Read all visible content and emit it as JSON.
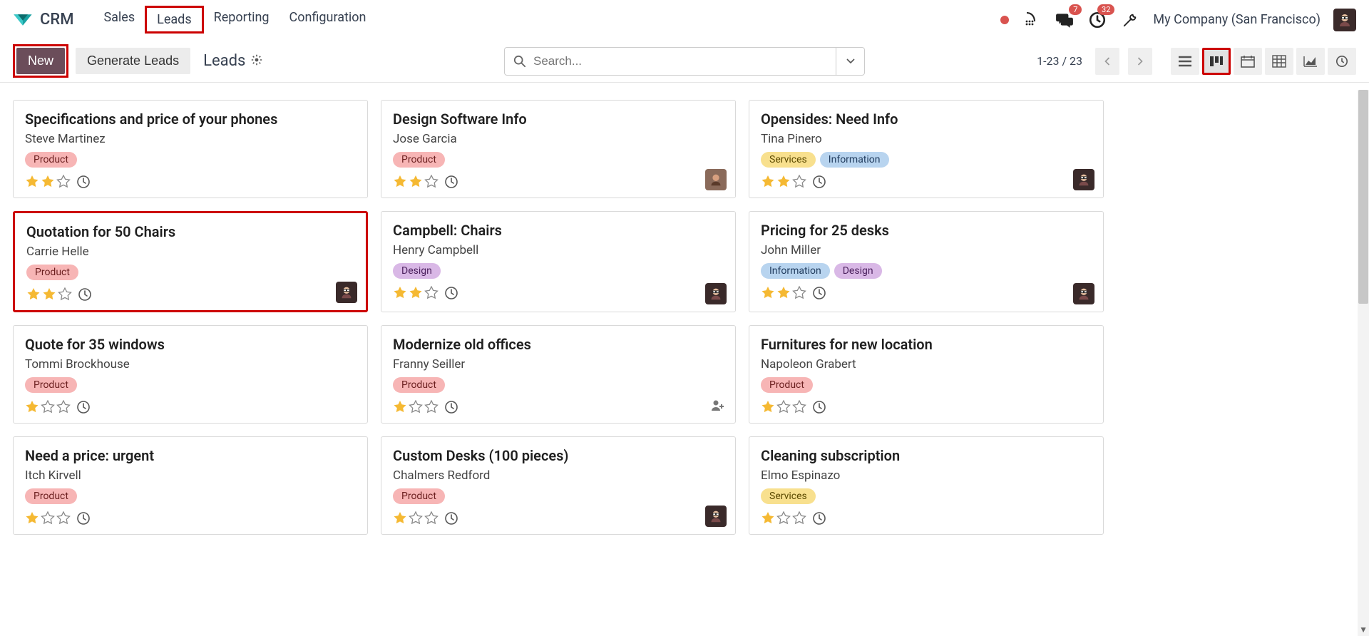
{
  "app": {
    "name": "CRM"
  },
  "nav": {
    "items": [
      {
        "label": "Sales"
      },
      {
        "label": "Leads"
      },
      {
        "label": "Reporting"
      },
      {
        "label": "Configuration"
      }
    ]
  },
  "header_right": {
    "messages_badge": "7",
    "activities_badge": "32",
    "company": "My Company (San Francisco)"
  },
  "controlbar": {
    "new_label": "New",
    "generate_label": "Generate Leads",
    "breadcrumb": "Leads",
    "search_placeholder": "Search...",
    "pager": "1-23 / 23"
  },
  "cards": [
    {
      "title": "Specifications and price of your phones",
      "contact": "Steve Martinez",
      "tags": [
        {
          "text": "Product",
          "cls": "tag-product"
        }
      ],
      "stars": 2,
      "avatar": null,
      "highlight": false
    },
    {
      "title": "Design Software Info",
      "contact": "Jose Garcia",
      "tags": [
        {
          "text": "Product",
          "cls": "tag-product"
        }
      ],
      "stars": 2,
      "avatar": "human",
      "highlight": false
    },
    {
      "title": "Opensides: Need Info",
      "contact": "Tina Pinero",
      "tags": [
        {
          "text": "Services",
          "cls": "tag-services"
        },
        {
          "text": "Information",
          "cls": "tag-information"
        }
      ],
      "stars": 2,
      "avatar": "bot",
      "highlight": false
    },
    {
      "title": "Quotation for 50 Chairs",
      "contact": "Carrie Helle",
      "tags": [
        {
          "text": "Product",
          "cls": "tag-product"
        }
      ],
      "stars": 2,
      "avatar": "bot",
      "highlight": true
    },
    {
      "title": "Campbell: Chairs",
      "contact": "Henry Campbell",
      "tags": [
        {
          "text": "Design",
          "cls": "tag-design"
        }
      ],
      "stars": 2,
      "avatar": "bot",
      "highlight": false
    },
    {
      "title": "Pricing for 25 desks",
      "contact": "John Miller",
      "tags": [
        {
          "text": "Information",
          "cls": "tag-information"
        },
        {
          "text": "Design",
          "cls": "tag-design"
        }
      ],
      "stars": 2,
      "avatar": "bot",
      "highlight": false
    },
    {
      "title": "Quote for 35 windows",
      "contact": "Tommi Brockhouse",
      "tags": [
        {
          "text": "Product",
          "cls": "tag-product"
        }
      ],
      "stars": 1,
      "avatar": null,
      "highlight": false
    },
    {
      "title": "Modernize old offices",
      "contact": "Franny Seiller",
      "tags": [
        {
          "text": "Product",
          "cls": "tag-product"
        }
      ],
      "stars": 1,
      "avatar": null,
      "highlight": false,
      "useradd": true
    },
    {
      "title": "Furnitures for new location",
      "contact": "Napoleon Grabert",
      "tags": [
        {
          "text": "Product",
          "cls": "tag-product"
        }
      ],
      "stars": 1,
      "avatar": null,
      "highlight": false
    },
    {
      "title": "Need a price: urgent",
      "contact": "Itch Kirvell",
      "tags": [
        {
          "text": "Product",
          "cls": "tag-product"
        }
      ],
      "stars": 1,
      "avatar": null,
      "highlight": false
    },
    {
      "title": "Custom Desks (100 pieces)",
      "contact": "Chalmers Redford",
      "tags": [
        {
          "text": "Product",
          "cls": "tag-product"
        }
      ],
      "stars": 1,
      "avatar": "bot",
      "highlight": false
    },
    {
      "title": "Cleaning subscription",
      "contact": "Elmo Espinazo",
      "tags": [
        {
          "text": "Services",
          "cls": "tag-services"
        }
      ],
      "stars": 1,
      "avatar": null,
      "highlight": false
    }
  ]
}
